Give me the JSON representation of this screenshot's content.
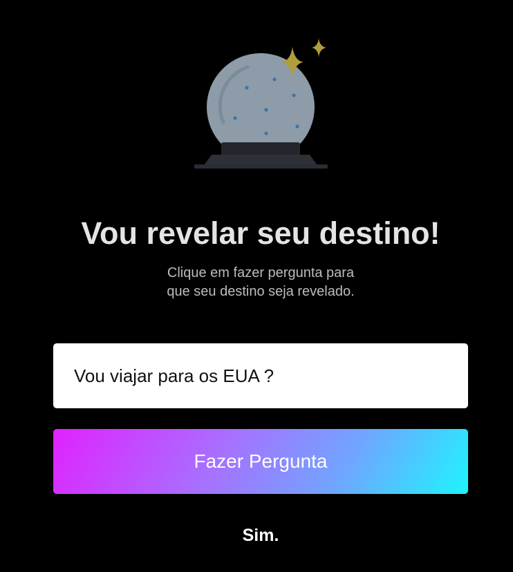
{
  "header": {
    "illustration_icon": "crystal-ball-icon",
    "title": "Vou revelar seu destino!",
    "subtitle_line1": "Clique em fazer pergunta para",
    "subtitle_line2": "que seu destino seja revelado."
  },
  "form": {
    "question_value": "Vou viajar para os EUA ?",
    "ask_button_label": "Fazer Pergunta"
  },
  "result": {
    "answer": "Sim."
  },
  "colors": {
    "background": "#000000",
    "title": "#e4e4e4",
    "subtitle": "#bcbcbc",
    "button_gradient_start": "#e022ff",
    "button_gradient_end": "#1ef4ff",
    "sparkle": "#b19d3c",
    "globe": "#8d9ca8"
  }
}
